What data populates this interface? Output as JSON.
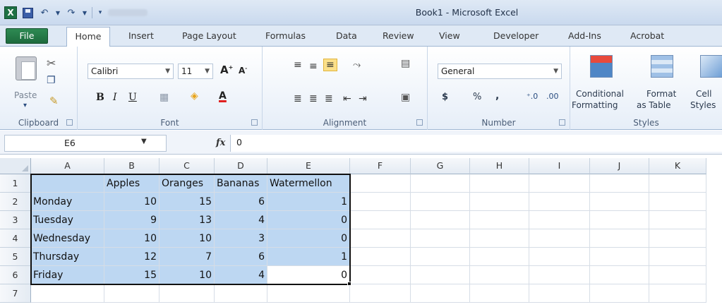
{
  "window": {
    "title": "Book1 - Microsoft Excel"
  },
  "tabs": [
    "File",
    "Home",
    "Insert",
    "Page Layout",
    "Formulas",
    "Data",
    "Review",
    "View",
    "Developer",
    "Add-Ins",
    "Acrobat"
  ],
  "ribbon": {
    "clipboard": {
      "paste_label": "Paste",
      "group_label": "Clipboard"
    },
    "font": {
      "name": "Calibri",
      "size": "11",
      "group_label": "Font"
    },
    "alignment": {
      "group_label": "Alignment"
    },
    "number": {
      "format": "General",
      "currency": "$",
      "percent": "%",
      "comma": ",",
      "group_label": "Number"
    },
    "styles": {
      "conditional_line1": "Conditional",
      "conditional_line2": "Formatting",
      "format_table_line1": "Format",
      "format_table_line2": "as Table",
      "cell_styles_line1": "Cell",
      "cell_styles_line2": "Styles",
      "group_label": "Styles"
    }
  },
  "formula_bar": {
    "name_box": "E6",
    "fx": "fx",
    "value": "0"
  },
  "grid": {
    "columns": [
      "A",
      "B",
      "C",
      "D",
      "E",
      "F",
      "G",
      "H",
      "I",
      "J",
      "K"
    ],
    "rows": [
      "1",
      "2",
      "3",
      "4",
      "5",
      "6",
      "7"
    ],
    "header_row": [
      "",
      "Apples",
      "Oranges",
      "Bananas",
      "Watermellon"
    ],
    "data_rows": [
      [
        "Monday",
        "10",
        "15",
        "6",
        "1"
      ],
      [
        "Tuesday",
        "9",
        "13",
        "4",
        "0"
      ],
      [
        "Wednesday",
        "10",
        "10",
        "3",
        "0"
      ],
      [
        "Thursday",
        "12",
        "7",
        "6",
        "1"
      ],
      [
        "Friday",
        "15",
        "10",
        "4",
        "0"
      ]
    ],
    "selection_color": "#bdd7f2",
    "active_cell": "E6"
  }
}
